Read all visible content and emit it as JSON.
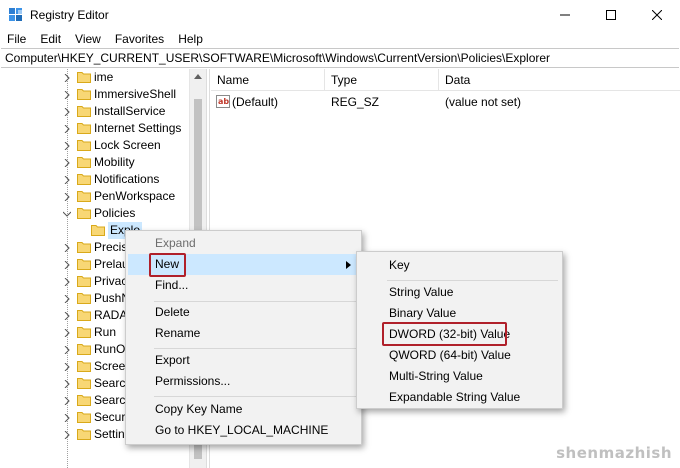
{
  "window": {
    "title": "Registry Editor"
  },
  "menubar": [
    "File",
    "Edit",
    "View",
    "Favorites",
    "Help"
  ],
  "address": "Computer\\HKEY_CURRENT_USER\\SOFTWARE\\Microsoft\\Windows\\CurrentVersion\\Policies\\Explorer",
  "tree": {
    "items": [
      {
        "label": "ime",
        "state": "collapsed"
      },
      {
        "label": "ImmersiveShell",
        "state": "collapsed"
      },
      {
        "label": "InstallService",
        "state": "collapsed"
      },
      {
        "label": "Internet Settings",
        "state": "collapsed"
      },
      {
        "label": "Lock Screen",
        "state": "collapsed"
      },
      {
        "label": "Mobility",
        "state": "collapsed"
      },
      {
        "label": "Notifications",
        "state": "collapsed"
      },
      {
        "label": "PenWorkspace",
        "state": "collapsed"
      },
      {
        "label": "Policies",
        "state": "expanded"
      },
      {
        "label": "Explo",
        "state": "selected-child"
      },
      {
        "label": "Precis",
        "state": "collapsed"
      },
      {
        "label": "Prelau",
        "state": "collapsed"
      },
      {
        "label": "Privac",
        "state": "collapsed"
      },
      {
        "label": "PushN",
        "state": "collapsed"
      },
      {
        "label": "RADA",
        "state": "collapsed"
      },
      {
        "label": "Run",
        "state": "collapsed"
      },
      {
        "label": "RunO",
        "state": "collapsed"
      },
      {
        "label": "Scree",
        "state": "collapsed"
      },
      {
        "label": "Searc",
        "state": "collapsed"
      },
      {
        "label": "Searc",
        "state": "collapsed"
      },
      {
        "label": "Secur",
        "state": "collapsed"
      },
      {
        "label": "Settin",
        "state": "collapsed"
      }
    ]
  },
  "list": {
    "columns": [
      "Name",
      "Type",
      "Data"
    ],
    "rows": [
      {
        "name": "(Default)",
        "type": "REG_SZ",
        "data": "(value not set)",
        "icon": "string-value-icon"
      }
    ]
  },
  "context_menu": {
    "expand": "Expand",
    "new": "New",
    "find": "Find...",
    "delete": "Delete",
    "rename": "Rename",
    "export": "Export",
    "permissions": "Permissions...",
    "copy_key_name": "Copy Key Name",
    "goto": "Go to HKEY_LOCAL_MACHINE"
  },
  "submenu": {
    "key": "Key",
    "string": "String Value",
    "binary": "Binary Value",
    "dword": "DWORD (32-bit) Value",
    "qword": "QWORD (64-bit) Value",
    "multistring": "Multi-String Value",
    "expandable": "Expandable String Value"
  },
  "watermark": "shenmazhish",
  "colors": {
    "highlight": "#cce8ff",
    "annotation_box": "#b0202a",
    "folder": "#f8d775"
  }
}
